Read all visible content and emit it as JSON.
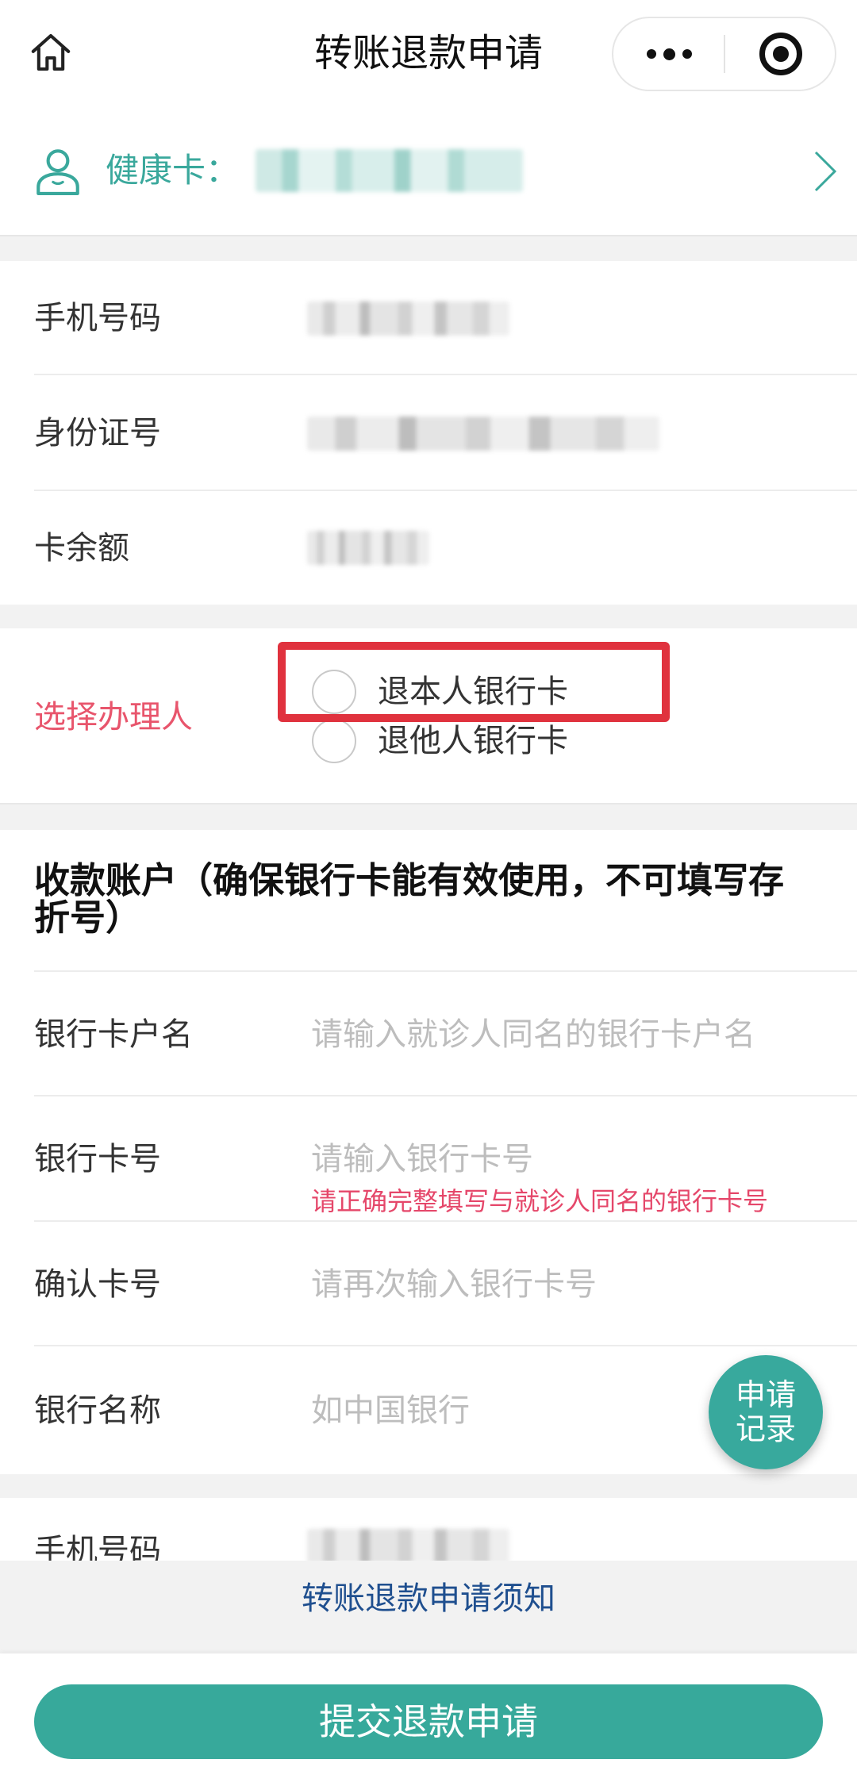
{
  "nav": {
    "title": "转账退款申请",
    "home_icon": "home-icon",
    "more_icon": "more-dots-icon",
    "close_icon": "target-circle-icon"
  },
  "health_card": {
    "label": "健康卡：",
    "icon": "user-outline-icon",
    "chevron_icon": "chevron-right-icon"
  },
  "info": {
    "rows": [
      {
        "label": "手机号码"
      },
      {
        "label": "身份证号"
      },
      {
        "label": "卡余额"
      }
    ]
  },
  "handler": {
    "label": "选择办理人",
    "options": [
      {
        "label": "退本人银行卡",
        "selected": false
      },
      {
        "label": "退他人银行卡",
        "selected": false
      }
    ]
  },
  "account": {
    "title": "收款账户（确保银行卡能有效使用，不可填写存折号）",
    "fields": [
      {
        "label": "银行卡户名",
        "placeholder": "请输入就诊人同名的银行卡户名",
        "value": ""
      },
      {
        "label": "银行卡号",
        "placeholder": "请输入银行卡号",
        "value": "",
        "hint": "请正确完整填写与就诊人同名的银行卡号"
      },
      {
        "label": "确认卡号",
        "placeholder": "请再次输入银行卡号",
        "value": ""
      },
      {
        "label": "银行名称",
        "placeholder": "如中国银行",
        "value": ""
      }
    ]
  },
  "contact": {
    "label": "手机号码"
  },
  "float_button": {
    "label": "申请记录"
  },
  "notice": {
    "link": "转账退款申请须知"
  },
  "submit": {
    "label": "提交退款申请"
  },
  "colors": {
    "primary": "#38a99d",
    "link": "#1f4f8f",
    "handler_label": "#e8556c",
    "hint": "#e5476a",
    "highlight": "#e0323e",
    "placeholder": "#bdbdbd"
  }
}
